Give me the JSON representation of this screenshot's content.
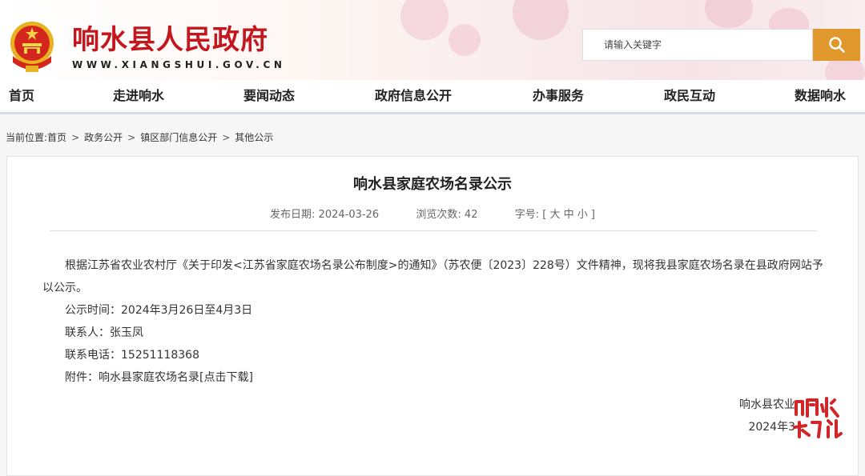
{
  "header": {
    "site_title": "响水县人民政府",
    "site_domain": "WWW.XIANGSHUI.GOV.CN",
    "search_placeholder": "请输入关键字",
    "colors": {
      "brand_red": "#c4161c",
      "search_button": "#e0972c"
    }
  },
  "nav": {
    "items": [
      {
        "label": "首页"
      },
      {
        "label": "走进响水"
      },
      {
        "label": "要闻动态"
      },
      {
        "label": "政府信息公开"
      },
      {
        "label": "办事服务"
      },
      {
        "label": "政民互动"
      },
      {
        "label": "数据响水"
      }
    ]
  },
  "breadcrumb": {
    "prefix": "当前位置:",
    "items": [
      "首页",
      "政务公开",
      "镇区部门信息公开",
      "其他公示"
    ],
    "separator": ">"
  },
  "article": {
    "title": "响水县家庭农场名录公示",
    "publish_label": "发布日期:",
    "publish_date": "2024-03-26",
    "views_label": "浏览次数:",
    "views": "42",
    "fontsize_label": "字号:",
    "fontsize_options": "[ 大 中 小 ]",
    "paragraph": "根据江苏省农业农村厅《关于印发<江苏省家庭农场名录公布制度>的通知》（苏农便〔2023〕228号）文件精神，现将我县家庭农场名录在县政府网站予以公示。",
    "notice_time": "公示时间：2024年3月26日至4月3日",
    "contact_person": "联系人：张玉凤",
    "contact_phone": "联系电话：15251118368",
    "attachment_label": "附件：",
    "attachment_link": "响水县家庭农场名录[点击下载]",
    "signoff_org": "响水县农业",
    "signoff_date": "2024年3"
  },
  "watermark": {
    "text": "响水热门",
    "color": "#d0262a"
  }
}
